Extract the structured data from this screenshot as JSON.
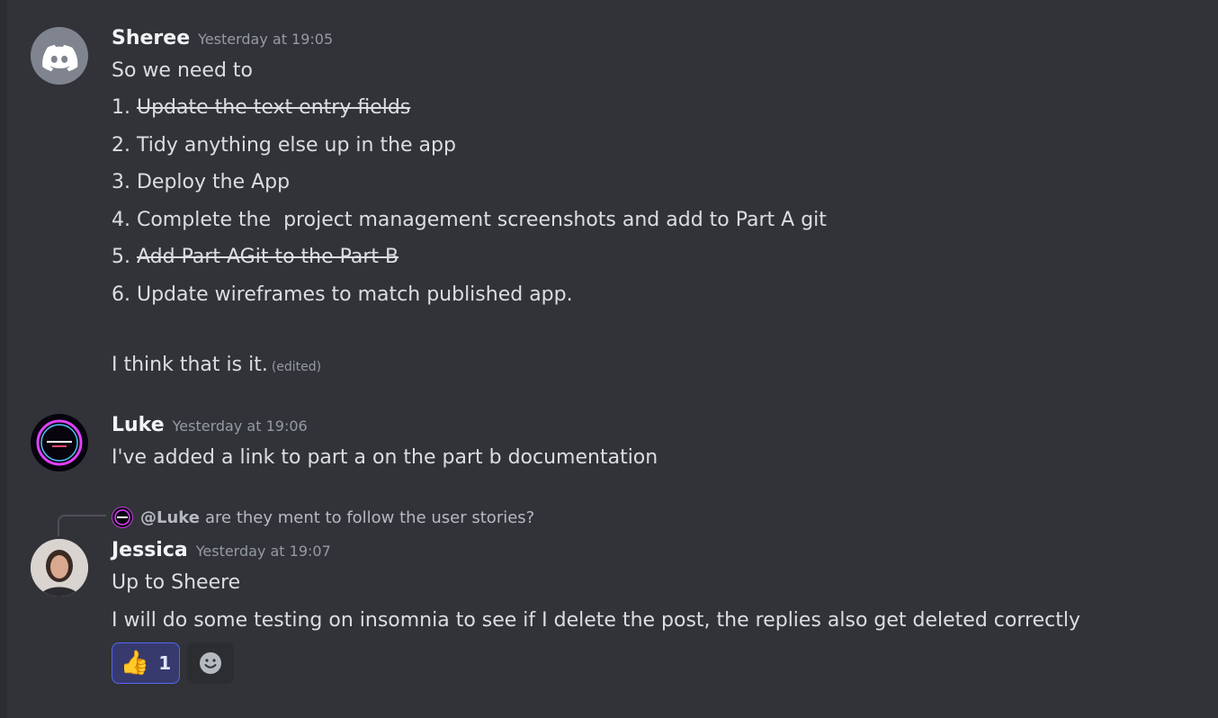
{
  "messages": [
    {
      "author": "Sheree",
      "timestamp": "Yesterday at 19:05",
      "lines": [
        {
          "prefix": "",
          "text": "So we need to",
          "struck": false
        },
        {
          "prefix": "1. ",
          "text": "Update the text entry fields ",
          "struck": true
        },
        {
          "prefix": "2. ",
          "text": "Tidy anything else up in the app",
          "struck": false
        },
        {
          "prefix": "3. ",
          "text": "Deploy the App",
          "struck": false
        },
        {
          "prefix": "4. ",
          "text": "Complete the  project management screenshots and add to Part A git",
          "struck": false
        },
        {
          "prefix": "5. ",
          "text": "Add Part AGit to the Part B",
          "struck": true
        },
        {
          "prefix": "6. ",
          "text": "Update wireframes to match published app.",
          "struck": false
        },
        {
          "prefix": "",
          "text": "I think that is it.",
          "struck": false
        }
      ],
      "edited_label": "(edited)"
    },
    {
      "author": "Luke",
      "timestamp": "Yesterday at 19:06",
      "lines": [
        {
          "text": "I've added a link to part a on the part b documentation"
        }
      ]
    },
    {
      "author": "Jessica",
      "timestamp": "Yesterday at 19:07",
      "reply_to": {
        "mention": "@Luke",
        "text": "are they ment to follow the user stories?"
      },
      "lines": [
        {
          "text": "Up to Sheere"
        },
        {
          "text": "I will do some testing on insomnia to see if I delete the post, the replies also get deleted correctly"
        }
      ],
      "reactions": [
        {
          "emoji": "👍",
          "count": "1"
        }
      ]
    }
  ],
  "colors": {
    "background": "#313338",
    "text": "#dbdee1",
    "muted": "#949ba4",
    "accent": "#5865f2",
    "discord_avatar": "#80848e"
  },
  "icons": [
    "discord-logo-icon",
    "smile-icon",
    "thumbs-up-icon"
  ]
}
